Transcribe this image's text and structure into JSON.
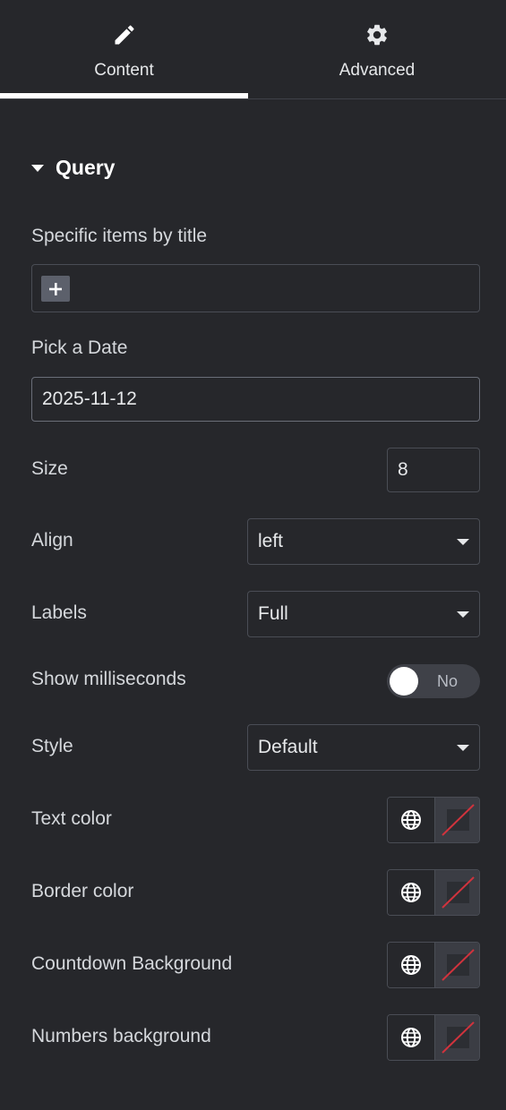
{
  "tabs": [
    {
      "label": "Content",
      "icon": "pencil-icon",
      "active": true
    },
    {
      "label": "Advanced",
      "icon": "gear-icon",
      "active": false
    }
  ],
  "section": {
    "title": "Query"
  },
  "fields": {
    "specific_items": {
      "label": "Specific items by title"
    },
    "pick_date": {
      "label": "Pick a Date",
      "value": "2025-11-12"
    },
    "size": {
      "label": "Size",
      "value": "8"
    },
    "align": {
      "label": "Align",
      "value": "left"
    },
    "labels": {
      "label": "Labels",
      "value": "Full"
    },
    "show_ms": {
      "label": "Show milliseconds",
      "toggle_text": "No",
      "checked": false
    },
    "style": {
      "label": "Style",
      "value": "Default"
    },
    "text_color": {
      "label": "Text color"
    },
    "border_color": {
      "label": "Border color"
    },
    "countdown_bg": {
      "label": "Countdown Background"
    },
    "numbers_bg": {
      "label": "Numbers background"
    }
  },
  "colors": {
    "background": "#26272b",
    "border": "#4a4d55",
    "no_color_slash": "#d0333d",
    "active_tab_underline": "#ffffff"
  }
}
